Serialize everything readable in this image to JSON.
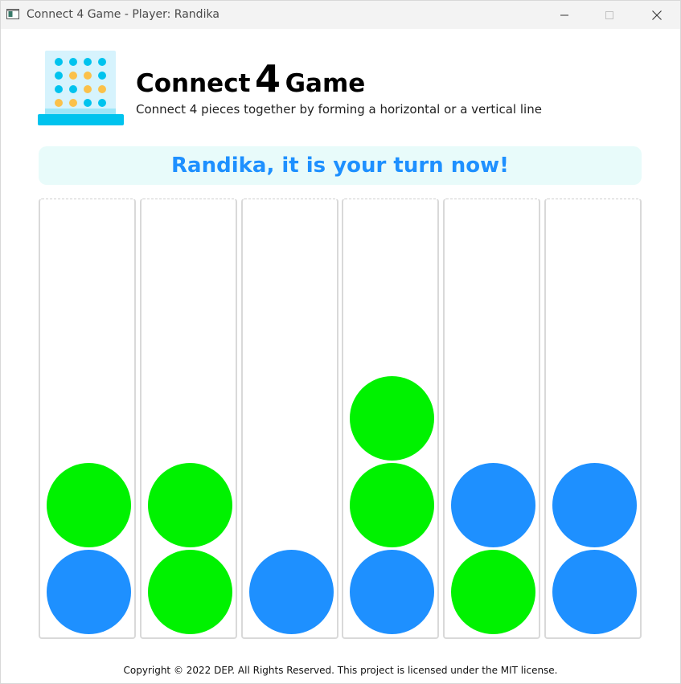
{
  "window": {
    "title": "Connect 4 Game - Player: Randika"
  },
  "header": {
    "title_word1": "Connect",
    "title_number": "4",
    "title_word2": "Game",
    "subtitle": "Connect 4 pieces together by forming a horizontal or a vertical line"
  },
  "status": {
    "message": "Randika, it is your turn now!"
  },
  "colors": {
    "green_piece": "#00f200",
    "blue_piece": "#1e90ff",
    "banner_bg": "#e8fbfa",
    "banner_text": "#1e90ff",
    "logo_cyan": "#00c3ee",
    "logo_yellow": "#fbc14a"
  },
  "board": {
    "columns": 6,
    "rows": 5,
    "pieces_bottom_up": [
      [
        "blue",
        "green"
      ],
      [
        "green",
        "green"
      ],
      [
        "blue"
      ],
      [
        "blue",
        "green",
        "green"
      ],
      [
        "green",
        "blue"
      ],
      [
        "blue",
        "blue"
      ]
    ]
  },
  "icons": {
    "app_icon": "window-app-icon",
    "logo": "connect4-board-logo",
    "minimize": "minimize-icon",
    "maximize": "maximize-icon",
    "close": "close-icon"
  },
  "footer": {
    "text": "Copyright © 2022 DEP. All Rights Reserved. This project is licensed under the MIT license."
  }
}
